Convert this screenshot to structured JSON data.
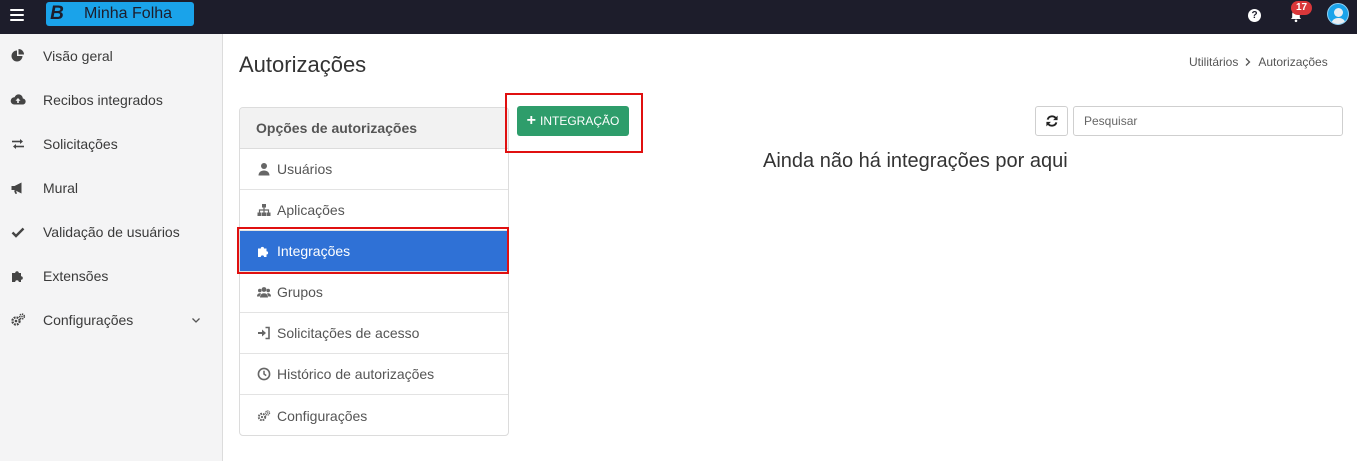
{
  "brand": {
    "logo_letter": "B",
    "name": "Minha Folha",
    "color": "#1aa3ea"
  },
  "topbar": {
    "help_icon": "question-icon",
    "notifications_count": "17",
    "bell_icon": "bell-icon"
  },
  "sidebar": {
    "items": [
      {
        "label": "Visão geral",
        "icon": "pie-chart-icon"
      },
      {
        "label": "Recibos integrados",
        "icon": "cloud-upload-icon"
      },
      {
        "label": "Solicitações",
        "icon": "exchange-arrows-icon"
      },
      {
        "label": "Mural",
        "icon": "megaphone-icon"
      },
      {
        "label": "Validação de usuários",
        "icon": "check-icon"
      },
      {
        "label": "Extensões",
        "icon": "puzzle-icon"
      },
      {
        "label": "Configurações",
        "icon": "gears-icon",
        "expandable": true
      }
    ]
  },
  "page": {
    "title": "Autorizações"
  },
  "breadcrumb": {
    "parent": "Utilitários",
    "current": "Autorizações"
  },
  "options_panel": {
    "header": "Opções de autorizações",
    "items": [
      {
        "label": "Usuários",
        "icon": "user-icon",
        "active": false
      },
      {
        "label": "Aplicações",
        "icon": "sitemap-icon",
        "active": false
      },
      {
        "label": "Integrações",
        "icon": "puzzle-icon",
        "active": true
      },
      {
        "label": "Grupos",
        "icon": "users-icon",
        "active": false
      },
      {
        "label": "Solicitações de acesso",
        "icon": "sign-in-icon",
        "active": false
      },
      {
        "label": "Histórico de autorizações",
        "icon": "clock-icon",
        "active": false
      },
      {
        "label": "Configurações",
        "icon": "gears-icon",
        "active": false
      }
    ]
  },
  "actions": {
    "add_integration_label": "INTEGRAÇÃO",
    "refresh_icon": "refresh-icon"
  },
  "search": {
    "placeholder": "Pesquisar",
    "value": ""
  },
  "empty_state": {
    "message": "Ainda não há integrações por aqui"
  },
  "colors": {
    "topbar": "#1d1d2b",
    "active_option": "#2f71d6",
    "primary_button": "#2e9d6b",
    "highlight": "#e01010",
    "badge": "#d9373a"
  }
}
